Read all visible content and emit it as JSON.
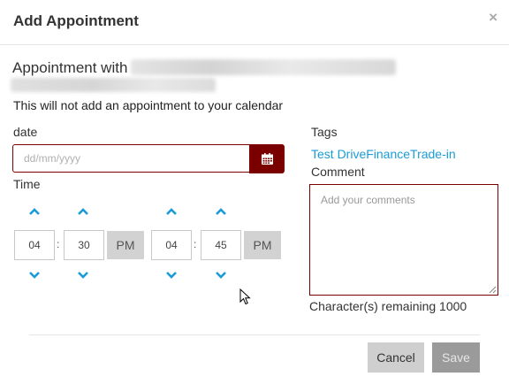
{
  "dialog": {
    "title": "Add Appointment",
    "close_glyph": "×"
  },
  "appointment": {
    "with_label": "Appointment with",
    "notice": "This will not add an appointment to your calendar"
  },
  "date": {
    "label": "date",
    "placeholder": "dd/mm/yyyy",
    "value": ""
  },
  "time": {
    "label": "Time",
    "start_hour": "04",
    "start_minute": "30",
    "start_period": "PM",
    "end_hour": "04",
    "end_minute": "45",
    "end_period": "PM",
    "separator": ":"
  },
  "tags": {
    "label": "Tags",
    "items": [
      "Test DriveFinanceTrade-in"
    ]
  },
  "comment": {
    "label": "Comment",
    "placeholder": "Add your comments",
    "remaining_text": "Character(s) remaining 1000"
  },
  "footer": {
    "cancel_label": "Cancel",
    "save_label": "Save"
  },
  "colors": {
    "accent_dark_red": "#7a0000",
    "link_blue": "#1a9bd7",
    "arrow_blue": "#1a9bd7"
  }
}
